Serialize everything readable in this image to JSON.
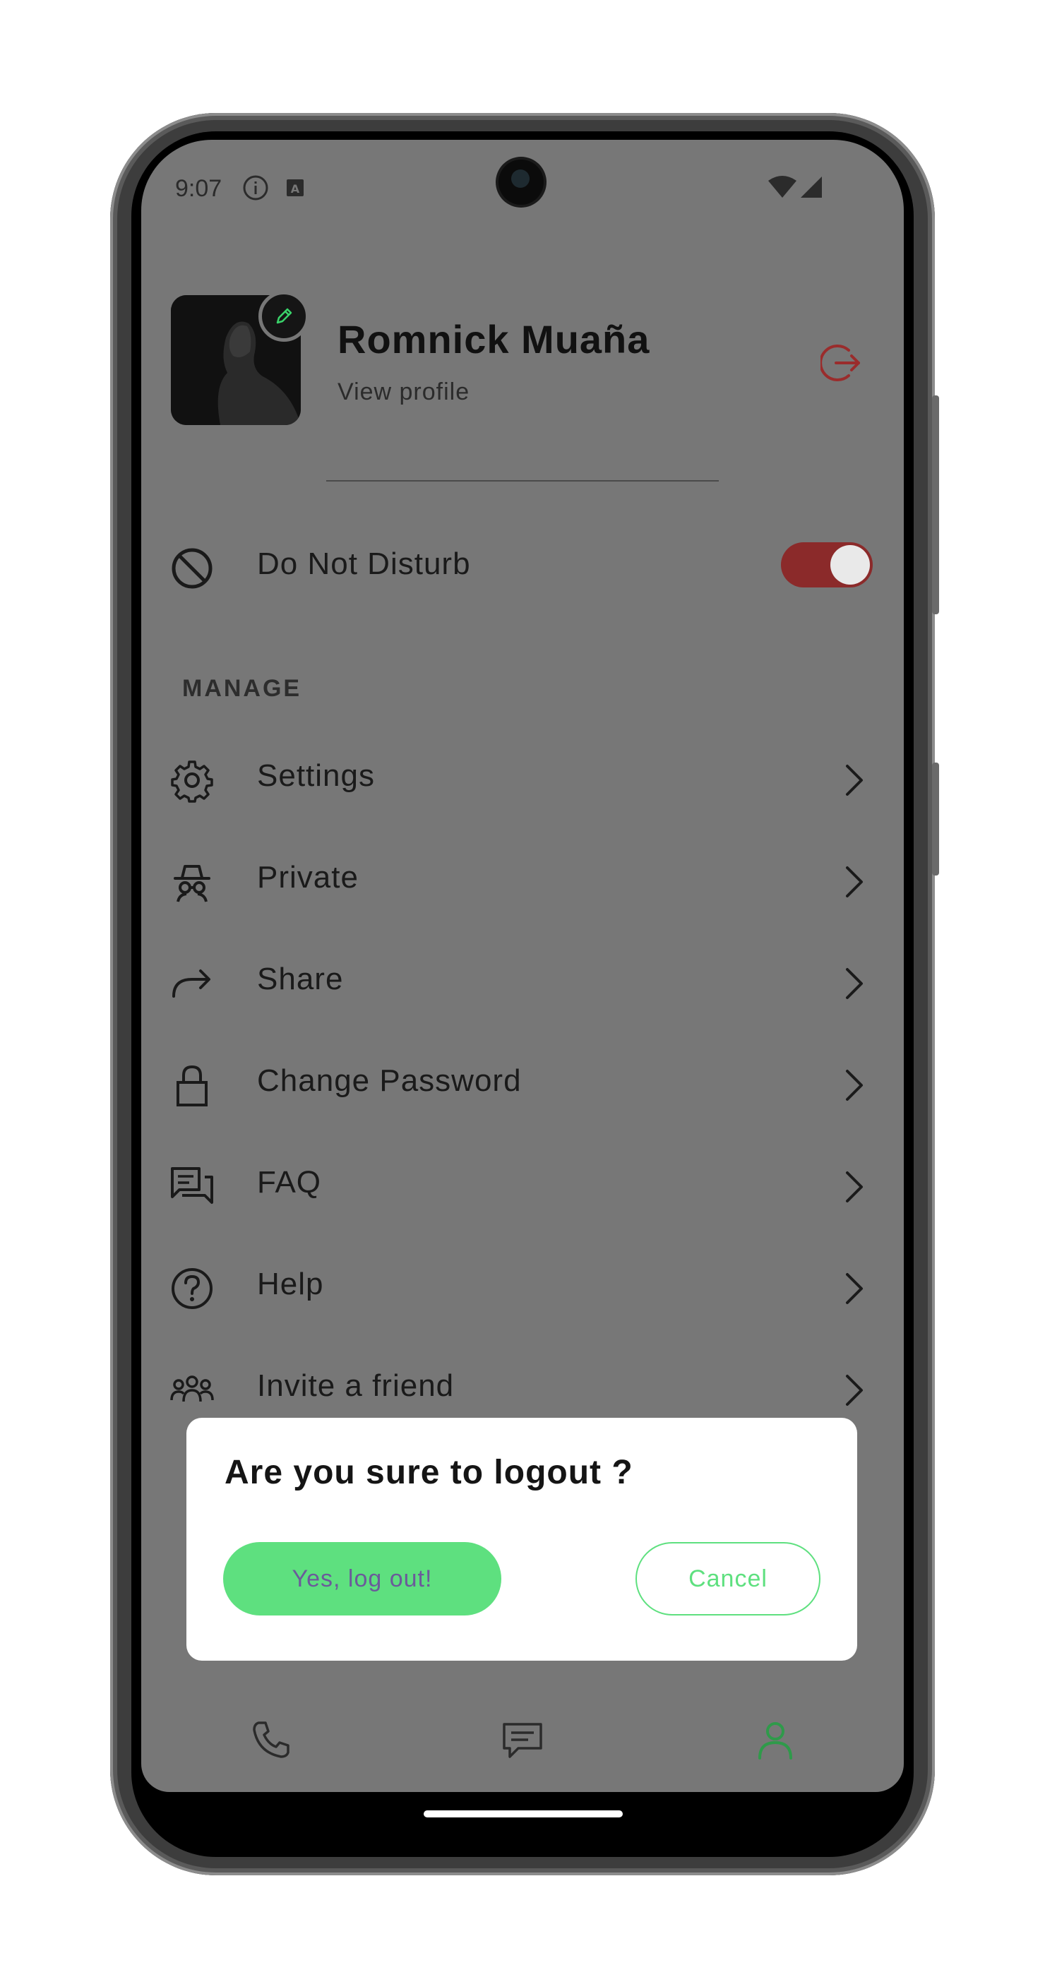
{
  "status_bar": {
    "time": "9:07"
  },
  "profile": {
    "name": "Romnick Muaña",
    "view_profile_label": "View profile"
  },
  "do_not_disturb": {
    "label": "Do Not Disturb",
    "enabled": true
  },
  "manage": {
    "section_title": "MANAGE",
    "items": [
      {
        "label": "Settings",
        "icon": "gear-icon"
      },
      {
        "label": "Private",
        "icon": "incognito-icon"
      },
      {
        "label": "Share",
        "icon": "share-icon"
      },
      {
        "label": "Change Password",
        "icon": "lock-icon"
      },
      {
        "label": "FAQ",
        "icon": "chat-bubbles-icon"
      },
      {
        "label": "Help",
        "icon": "help-circle-icon"
      },
      {
        "label": "Invite a friend",
        "icon": "people-icon"
      }
    ]
  },
  "logout_dialog": {
    "title": "Are you sure to logout ?",
    "confirm_label": "Yes, log out!",
    "cancel_label": "Cancel"
  },
  "bottom_nav": {
    "items": [
      {
        "icon": "phone-icon",
        "active": false
      },
      {
        "icon": "message-icon",
        "active": false
      },
      {
        "icon": "person-icon",
        "active": true
      }
    ]
  },
  "colors": {
    "accent_green": "#5ee07f",
    "logout_red": "#8b2a2a",
    "overlay_gray": "#777777"
  }
}
